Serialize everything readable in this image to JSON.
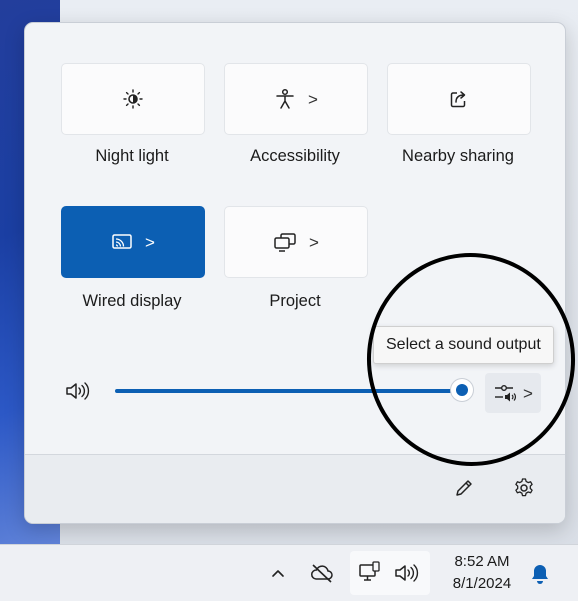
{
  "quick_settings": {
    "tiles": [
      {
        "label": "Night light",
        "icon": "night-light-icon",
        "active": false,
        "chevron": false
      },
      {
        "label": "Accessibility",
        "icon": "accessibility-icon",
        "active": false,
        "chevron": true
      },
      {
        "label": "Nearby sharing",
        "icon": "share-icon",
        "active": false,
        "chevron": false
      },
      {
        "label": "Wired display",
        "icon": "cast-icon",
        "active": true,
        "chevron": true
      },
      {
        "label": "Project",
        "icon": "project-icon",
        "active": false,
        "chevron": true
      }
    ],
    "chevron_glyph": ">",
    "volume": {
      "level_fraction": 0.95,
      "icon": "speaker-icon"
    },
    "sound_output_tooltip": "Select a sound output",
    "footer": {
      "edit_icon": "pencil-icon",
      "settings_icon": "gear-icon"
    }
  },
  "taskbar": {
    "time": "8:52 AM",
    "date": "8/1/2024",
    "icons": [
      "chevron-up-icon",
      "cloud-off-icon",
      "network-icon",
      "speaker-icon",
      "bell-icon"
    ]
  },
  "colors": {
    "accent": "#0c5fb3",
    "annotation": "#000000"
  }
}
